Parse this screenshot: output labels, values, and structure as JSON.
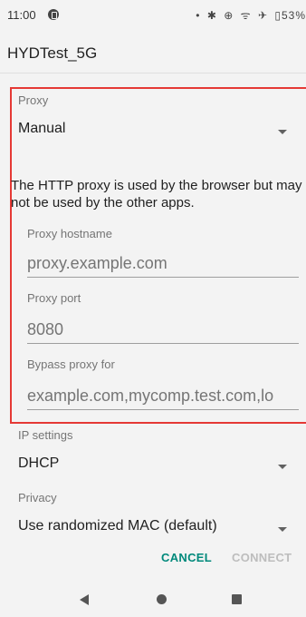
{
  "status_bar": {
    "time": "11:00",
    "icons": [
      "•",
      "✱",
      "⊕",
      "ᯤ",
      "✈",
      "▯53%"
    ]
  },
  "dialog": {
    "title": "HYDTest_5G"
  },
  "proxy": {
    "label": "Proxy",
    "selected": "Manual",
    "info": "The HTTP proxy is used by the browser but may not be used by the other apps.",
    "hostname_label": "Proxy hostname",
    "hostname_placeholder": "proxy.example.com",
    "port_label": "Proxy port",
    "port_placeholder": "8080",
    "bypass_label": "Bypass proxy for",
    "bypass_placeholder": "example.com,mycomp.test.com,lo"
  },
  "ip_settings": {
    "label": "IP settings",
    "selected": "DHCP"
  },
  "privacy": {
    "label": "Privacy",
    "selected": "Use randomized MAC (default)"
  },
  "actions": {
    "cancel": "CANCEL",
    "connect": "CONNECT"
  },
  "colors": {
    "accent": "#00897b",
    "highlight_border": "#e53935",
    "disabled": "#bdbdbd"
  }
}
